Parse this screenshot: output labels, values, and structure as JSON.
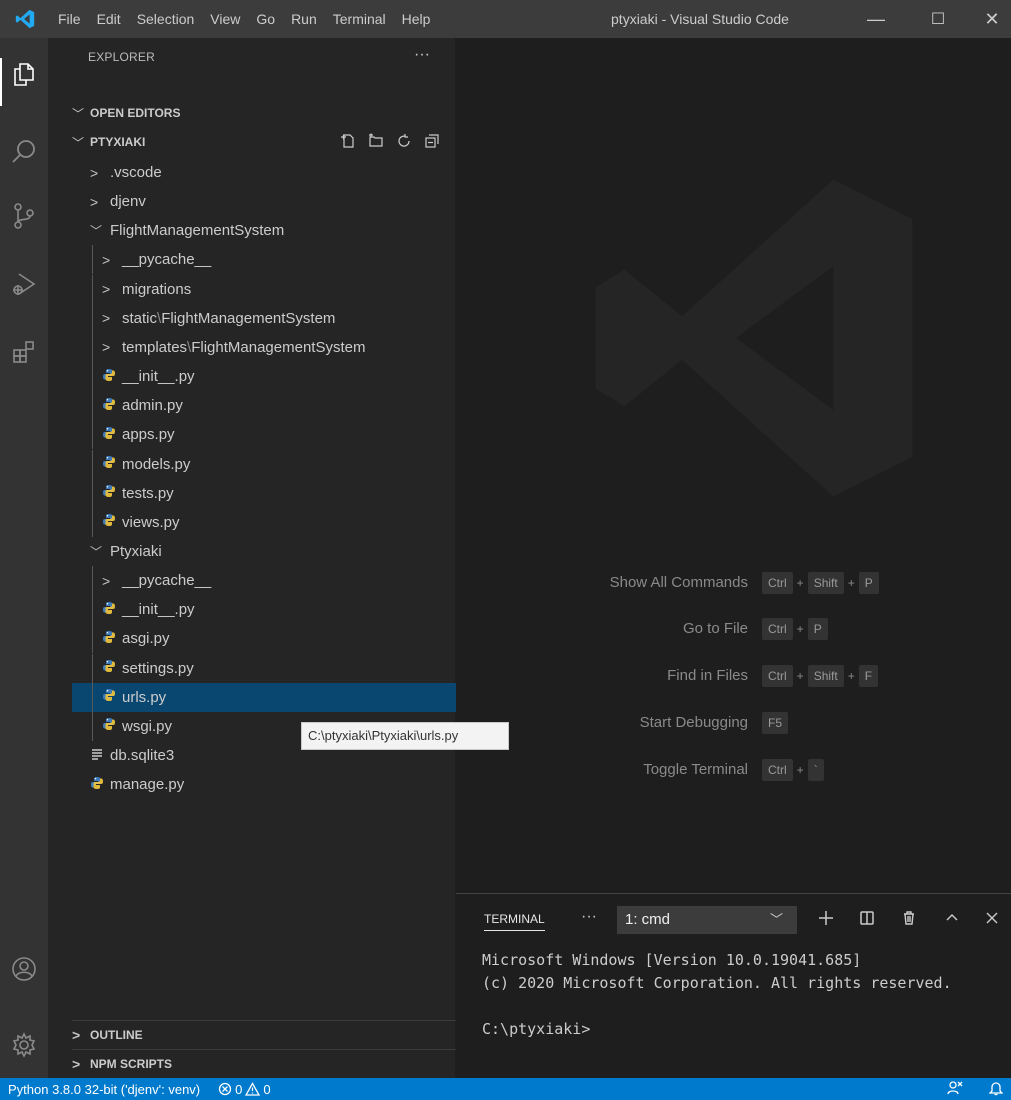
{
  "titlebar": {
    "menu": [
      "File",
      "Edit",
      "Selection",
      "View",
      "Go",
      "Run",
      "Terminal",
      "Help"
    ],
    "window_title": "ptyxiaki - Visual Studio Code",
    "minimize": "—",
    "maximize": "☐",
    "close": "✕"
  },
  "activitybar": {
    "items": [
      "explorer-icon",
      "search-icon",
      "source-control-icon",
      "run-debug-icon",
      "extensions-icon"
    ],
    "bottom": [
      "accounts-icon",
      "manage-gear-icon"
    ]
  },
  "sidebar": {
    "title": "EXPLORER",
    "more": "···",
    "open_editors": "OPEN EDITORS",
    "folder": "PTYXIAKI",
    "tree": [
      {
        "label": ".vscode",
        "type": "folder",
        "depth": 0
      },
      {
        "label": "djenv",
        "type": "folder",
        "depth": 0
      },
      {
        "label": "FlightManagementSystem",
        "type": "folder-open",
        "depth": 0
      },
      {
        "label": "__pycache__",
        "type": "folder",
        "depth": 1
      },
      {
        "label": "migrations",
        "type": "folder",
        "depth": 1
      },
      {
        "label": "static",
        "suffix": "FlightManagementSystem",
        "type": "folder",
        "depth": 1
      },
      {
        "label": "templates",
        "suffix": "FlightManagementSystem",
        "type": "folder",
        "depth": 1
      },
      {
        "label": "__init__.py",
        "type": "py",
        "depth": 1
      },
      {
        "label": "admin.py",
        "type": "py",
        "depth": 1
      },
      {
        "label": "apps.py",
        "type": "py",
        "depth": 1
      },
      {
        "label": "models.py",
        "type": "py",
        "depth": 1
      },
      {
        "label": "tests.py",
        "type": "py",
        "depth": 1
      },
      {
        "label": "views.py",
        "type": "py",
        "depth": 1
      },
      {
        "label": "Ptyxiaki",
        "type": "folder-open",
        "depth": 0
      },
      {
        "label": "__pycache__",
        "type": "folder",
        "depth": 1
      },
      {
        "label": "__init__.py",
        "type": "py",
        "depth": 1
      },
      {
        "label": "asgi.py",
        "type": "py",
        "depth": 1
      },
      {
        "label": "settings.py",
        "type": "py",
        "depth": 1
      },
      {
        "label": "urls.py",
        "type": "py",
        "depth": 1,
        "selected": true
      },
      {
        "label": "wsgi.py",
        "type": "py",
        "depth": 1
      },
      {
        "label": "db.sqlite3",
        "type": "db",
        "depth": 0
      },
      {
        "label": "manage.py",
        "type": "py",
        "depth": 0
      }
    ],
    "outline": "OUTLINE",
    "npm_scripts": "NPM SCRIPTS",
    "tooltip": "C:\\ptyxiaki\\Ptyxiaki\\urls.py"
  },
  "editor": {
    "shortcuts": [
      {
        "label": "Show All Commands",
        "keys": [
          "Ctrl",
          "Shift",
          "P"
        ]
      },
      {
        "label": "Go to File",
        "keys": [
          "Ctrl",
          "P"
        ]
      },
      {
        "label": "Find in Files",
        "keys": [
          "Ctrl",
          "Shift",
          "F"
        ]
      },
      {
        "label": "Start Debugging",
        "keys": [
          "F5"
        ]
      },
      {
        "label": "Toggle Terminal",
        "keys": [
          "Ctrl",
          "`"
        ]
      }
    ]
  },
  "panel": {
    "tab": "TERMINAL",
    "more": "···",
    "terminal_select": "1: cmd",
    "lines": [
      "Microsoft Windows [Version 10.0.19041.685]",
      "(c) 2020 Microsoft Corporation. All rights reserved.",
      "",
      "C:\\ptyxiaki>"
    ]
  },
  "statusbar": {
    "interpreter": "Python 3.8.0 32-bit ('djenv': venv)",
    "errors": "0",
    "warnings": "0"
  }
}
